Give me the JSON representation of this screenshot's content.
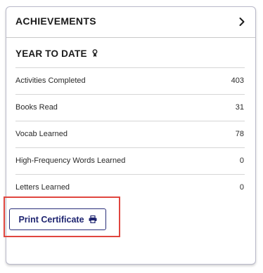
{
  "card": {
    "title": "ACHIEVEMENTS",
    "section_title": "YEAR TO DATE",
    "stats": [
      {
        "label": "Activities Completed",
        "value": "403"
      },
      {
        "label": "Books Read",
        "value": "31"
      },
      {
        "label": "Vocab Learned",
        "value": "78"
      },
      {
        "label": "High-Frequency Words Learned",
        "value": "0"
      },
      {
        "label": "Letters Learned",
        "value": "0"
      }
    ],
    "print_button_label": "Print Certificate"
  },
  "icons": {
    "header_action": "chevron-right-icon",
    "section_badge": "ribbon-icon",
    "print": "printer-icon"
  },
  "colors": {
    "button_border": "#2a2f7a",
    "button_text": "#1e2470",
    "highlight": "#e0463f"
  }
}
